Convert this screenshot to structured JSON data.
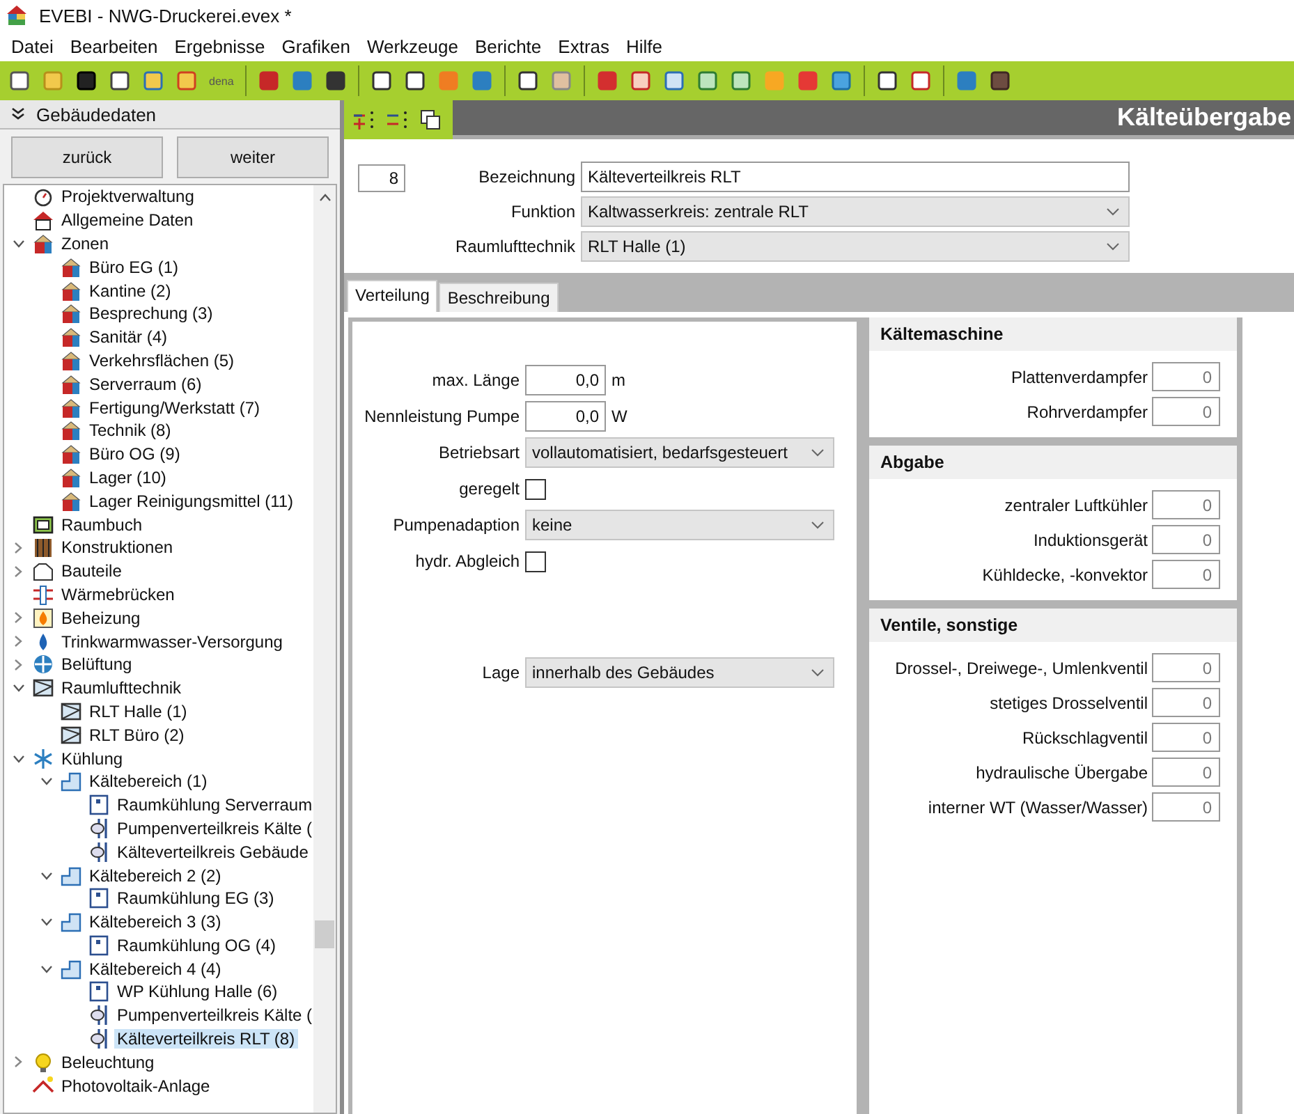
{
  "window": {
    "title": "EVEBI - NWG-Druckerei.evex *"
  },
  "menu": [
    "Datei",
    "Bearbeiten",
    "Ergebnisse",
    "Grafiken",
    "Werkzeuge",
    "Berichte",
    "Extras",
    "Hilfe"
  ],
  "toolbar": {
    "dena_label": "dena"
  },
  "sidebar": {
    "title": "Gebäudedaten",
    "buttons": [
      "zurück",
      "weiter"
    ],
    "tree": [
      {
        "label": "Projektverwaltung",
        "kind": "stopwatch",
        "selected": false
      },
      {
        "label": "Allgemeine Daten",
        "kind": "house",
        "selected": false
      },
      {
        "label": "Zonen",
        "kind": "zone",
        "selected": false,
        "expanded": true,
        "children": [
          {
            "label": "Büro EG (1)",
            "kind": "zone",
            "selected": false
          },
          {
            "label": "Kantine (2)",
            "kind": "zone",
            "selected": false
          },
          {
            "label": "Besprechung (3)",
            "kind": "zone",
            "selected": false
          },
          {
            "label": "Sanitär (4)",
            "kind": "zone",
            "selected": false
          },
          {
            "label": "Verkehrsflächen (5)",
            "kind": "zone",
            "selected": false
          },
          {
            "label": "Serverraum (6)",
            "kind": "zone",
            "selected": false
          },
          {
            "label": "Fertigung/Werkstatt (7)",
            "kind": "zone",
            "selected": false
          },
          {
            "label": "Technik (8)",
            "kind": "zone",
            "selected": false
          },
          {
            "label": "Büro OG (9)",
            "kind": "zone",
            "selected": false
          },
          {
            "label": "Lager (10)",
            "kind": "zone",
            "selected": false
          },
          {
            "label": "Lager Reinigungsmittel (11)",
            "kind": "zone",
            "selected": false
          }
        ]
      },
      {
        "label": "Raumbuch",
        "kind": "book",
        "selected": false
      },
      {
        "label": "Konstruktionen",
        "kind": "layers",
        "selected": false,
        "expanded": false
      },
      {
        "label": "Bauteile",
        "kind": "outline",
        "selected": false,
        "expanded": false
      },
      {
        "label": "Wärmebrücken",
        "kind": "bridge",
        "selected": false
      },
      {
        "label": "Beheizung",
        "kind": "flame",
        "selected": false,
        "expanded": false
      },
      {
        "label": "Trinkwarmwasser-Versorgung",
        "kind": "drop",
        "selected": false,
        "expanded": false
      },
      {
        "label": "Belüftung",
        "kind": "fan",
        "selected": false,
        "expanded": false
      },
      {
        "label": "Raumlufttechnik",
        "kind": "duct",
        "selected": false,
        "expanded": true,
        "children": [
          {
            "label": "RLT Halle (1)",
            "kind": "duct",
            "selected": false
          },
          {
            "label": "RLT Büro (2)",
            "kind": "duct",
            "selected": false
          }
        ]
      },
      {
        "label": "Kühlung",
        "kind": "snow",
        "selected": false,
        "expanded": true,
        "children": [
          {
            "label": "Kältebereich (1)",
            "kind": "area",
            "selected": false,
            "expanded": true,
            "children": [
              {
                "label": "Raumkühlung Serverraum",
                "kind": "unit",
                "selected": false
              },
              {
                "label": "Pumpenverteilkreis Kälte (",
                "kind": "pump",
                "selected": false
              },
              {
                "label": "Kälteverteilkreis Gebäude",
                "kind": "pump",
                "selected": false
              }
            ]
          },
          {
            "label": "Kältebereich 2 (2)",
            "kind": "area",
            "selected": false,
            "expanded": true,
            "children": [
              {
                "label": "Raumkühlung EG (3)",
                "kind": "unit",
                "selected": false
              }
            ]
          },
          {
            "label": "Kältebereich 3 (3)",
            "kind": "area",
            "selected": false,
            "expanded": true,
            "children": [
              {
                "label": "Raumkühlung OG (4)",
                "kind": "unit",
                "selected": false
              }
            ]
          },
          {
            "label": "Kältebereich 4 (4)",
            "kind": "area",
            "selected": false,
            "expanded": true,
            "children": [
              {
                "label": "WP Kühlung Halle (6)",
                "kind": "unit",
                "selected": false
              },
              {
                "label": "Pumpenverteilkreis Kälte (",
                "kind": "pump",
                "selected": false
              },
              {
                "label": "Kälteverteilkreis RLT (8)",
                "kind": "pump",
                "selected": true
              }
            ]
          }
        ]
      },
      {
        "label": "Beleuchtung",
        "kind": "bulb",
        "selected": false,
        "expanded": false
      },
      {
        "label": "Photovoltaik-Anlage",
        "kind": "solar",
        "selected": false
      }
    ]
  },
  "page_title": "Kälteübergabe",
  "header": {
    "number": "8",
    "fields": [
      {
        "label": "Bezeichnung",
        "kind": "text",
        "value": "Kälteverteilkreis RLT"
      },
      {
        "label": "Funktion",
        "kind": "select",
        "value": "Kaltwasserkreis: zentrale RLT"
      },
      {
        "label": "Raumlufttechnik",
        "kind": "select",
        "value": "RLT Halle (1)"
      }
    ]
  },
  "tabs": [
    {
      "label": "Verteilung",
      "selected": true
    },
    {
      "label": "Beschreibung",
      "selected": false
    }
  ],
  "settings": [
    {
      "label": "max. Länge",
      "kind": "number",
      "value": "0,0",
      "unit": "m"
    },
    {
      "label": "Nennleistung Pumpe",
      "kind": "number",
      "value": "0,0",
      "unit": "W"
    },
    {
      "label": "Betriebsart",
      "kind": "select",
      "value": "vollautomatisiert, bedarfsgesteuert"
    },
    {
      "label": "geregelt",
      "kind": "checkbox",
      "checked": false
    },
    {
      "label": "Pumpenadaption",
      "kind": "select",
      "value": "keine"
    },
    {
      "label": "hydr. Abgleich",
      "kind": "checkbox",
      "checked": false
    }
  ],
  "location": {
    "label": "Lage",
    "value": "innerhalb des Gebäudes"
  },
  "groups": [
    {
      "title": "Kältemaschine",
      "rows": [
        {
          "label": "Plattenverdampfer",
          "value": "0"
        },
        {
          "label": "Rohrverdampfer",
          "value": "0"
        }
      ]
    },
    {
      "title": "Abgabe",
      "rows": [
        {
          "label": "zentraler Luftkühler",
          "value": "0"
        },
        {
          "label": "Induktionsgerät",
          "value": "0"
        },
        {
          "label": "Kühldecke, -konvektor",
          "value": "0"
        }
      ]
    },
    {
      "title": "Ventile, sonstige",
      "rows": [
        {
          "label": "Drossel-, Dreiwege-, Umlenkventil",
          "value": "0"
        },
        {
          "label": "stetiges Drosselventil",
          "value": "0"
        },
        {
          "label": "Rückschlagventil",
          "value": "0"
        },
        {
          "label": "hydraulische Übergabe",
          "value": "0"
        },
        {
          "label": "interner WT (Wasser/Wasser)",
          "value": "0"
        }
      ]
    }
  ]
}
